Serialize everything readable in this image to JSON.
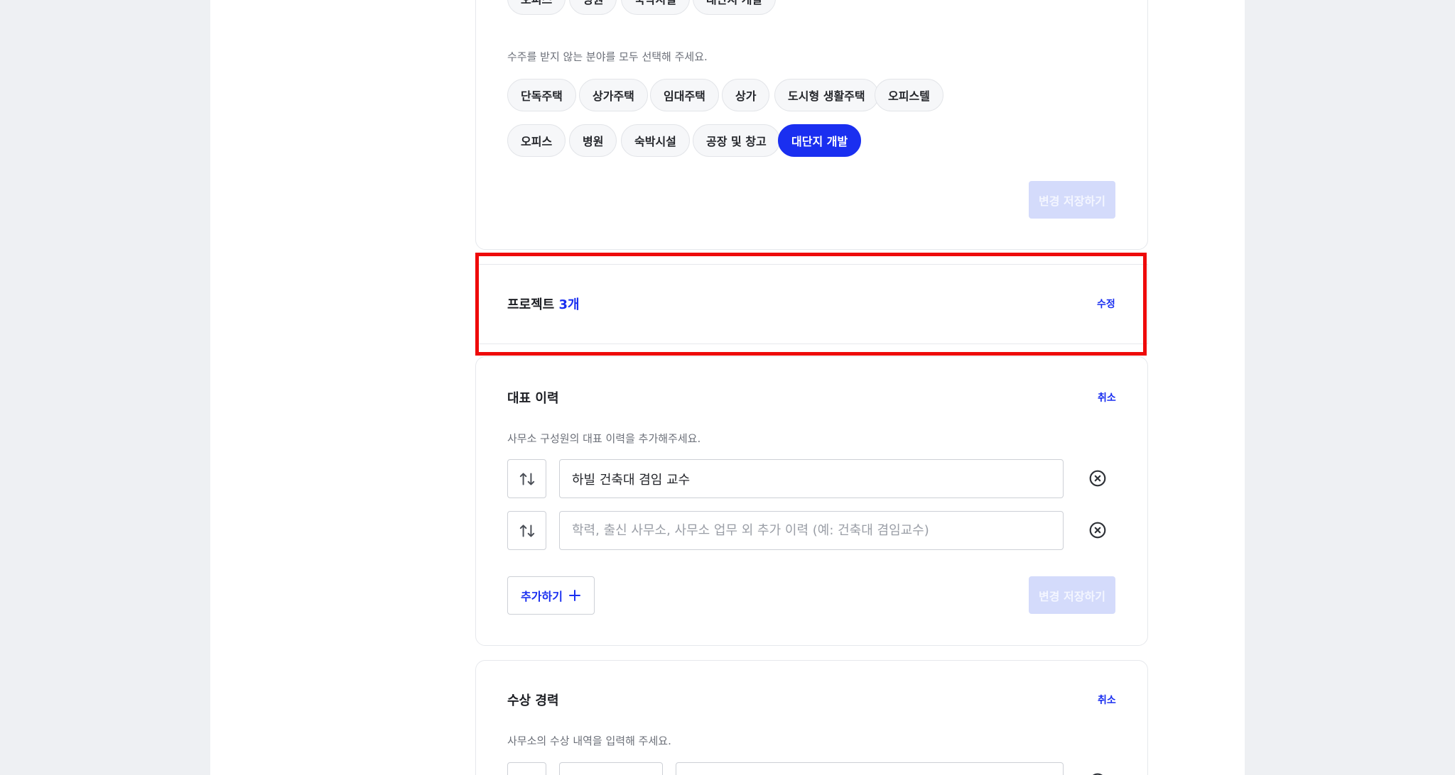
{
  "field_section": {
    "top_chips": [
      "오피스",
      "병원",
      "숙박시설",
      "대단지 개발"
    ],
    "hint": "수주를 받지 않는 분야를 모두 선택해 주세요.",
    "chips_row1": [
      "단독주택",
      "상가주택",
      "임대주택",
      "상가",
      "도시형 생활주택",
      "오피스텔"
    ],
    "chips_row2": [
      "오피스",
      "병원",
      "숙박시설",
      "공장 및 창고",
      "대단지 개발"
    ],
    "selected_chip": "대단지 개발",
    "save_label": "변경 저장하기"
  },
  "project_section": {
    "title": "프로젝트",
    "count": "3개",
    "edit_label": "수정"
  },
  "career_section": {
    "title": "대표 이력",
    "cancel_label": "취소",
    "hint": "사무소 구성원의 대표 이력을 추가해주세요.",
    "entries": [
      {
        "value": "하빌 건축대 겸임 교수",
        "placeholder": ""
      },
      {
        "value": "",
        "placeholder": "학력, 출신 사무소, 사무소 업무 외 추가 이력 (예: 건축대 겸임교수)"
      }
    ],
    "add_label": "추가하기",
    "save_label": "변경 저장하기"
  },
  "award_section": {
    "title": "수상 경력",
    "cancel_label": "취소",
    "hint": "사무소의 수상 내역을 입력해 주세요."
  },
  "colors": {
    "accent": "#1a2ff0",
    "highlight": "#ee0a0a",
    "disabled_button": "#d4dbfb"
  }
}
